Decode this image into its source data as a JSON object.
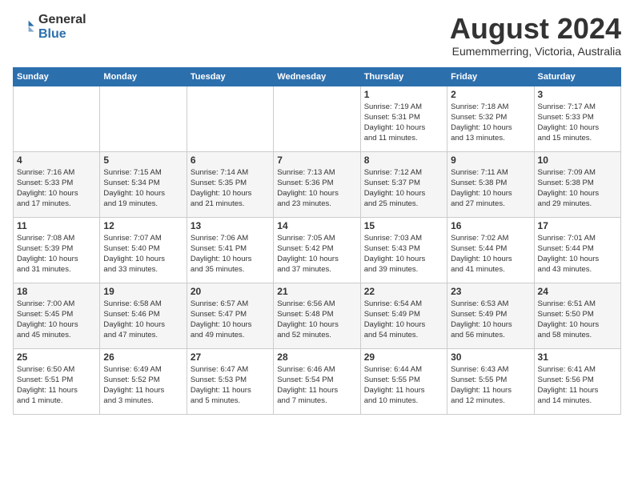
{
  "logo": {
    "general": "General",
    "blue": "Blue"
  },
  "title": "August 2024",
  "location": "Eumemmerring, Victoria, Australia",
  "days_header": [
    "Sunday",
    "Monday",
    "Tuesday",
    "Wednesday",
    "Thursday",
    "Friday",
    "Saturday"
  ],
  "weeks": [
    [
      {
        "day": "",
        "info": ""
      },
      {
        "day": "",
        "info": ""
      },
      {
        "day": "",
        "info": ""
      },
      {
        "day": "",
        "info": ""
      },
      {
        "day": "1",
        "info": "Sunrise: 7:19 AM\nSunset: 5:31 PM\nDaylight: 10 hours\nand 11 minutes."
      },
      {
        "day": "2",
        "info": "Sunrise: 7:18 AM\nSunset: 5:32 PM\nDaylight: 10 hours\nand 13 minutes."
      },
      {
        "day": "3",
        "info": "Sunrise: 7:17 AM\nSunset: 5:33 PM\nDaylight: 10 hours\nand 15 minutes."
      }
    ],
    [
      {
        "day": "4",
        "info": "Sunrise: 7:16 AM\nSunset: 5:33 PM\nDaylight: 10 hours\nand 17 minutes."
      },
      {
        "day": "5",
        "info": "Sunrise: 7:15 AM\nSunset: 5:34 PM\nDaylight: 10 hours\nand 19 minutes."
      },
      {
        "day": "6",
        "info": "Sunrise: 7:14 AM\nSunset: 5:35 PM\nDaylight: 10 hours\nand 21 minutes."
      },
      {
        "day": "7",
        "info": "Sunrise: 7:13 AM\nSunset: 5:36 PM\nDaylight: 10 hours\nand 23 minutes."
      },
      {
        "day": "8",
        "info": "Sunrise: 7:12 AM\nSunset: 5:37 PM\nDaylight: 10 hours\nand 25 minutes."
      },
      {
        "day": "9",
        "info": "Sunrise: 7:11 AM\nSunset: 5:38 PM\nDaylight: 10 hours\nand 27 minutes."
      },
      {
        "day": "10",
        "info": "Sunrise: 7:09 AM\nSunset: 5:38 PM\nDaylight: 10 hours\nand 29 minutes."
      }
    ],
    [
      {
        "day": "11",
        "info": "Sunrise: 7:08 AM\nSunset: 5:39 PM\nDaylight: 10 hours\nand 31 minutes."
      },
      {
        "day": "12",
        "info": "Sunrise: 7:07 AM\nSunset: 5:40 PM\nDaylight: 10 hours\nand 33 minutes."
      },
      {
        "day": "13",
        "info": "Sunrise: 7:06 AM\nSunset: 5:41 PM\nDaylight: 10 hours\nand 35 minutes."
      },
      {
        "day": "14",
        "info": "Sunrise: 7:05 AM\nSunset: 5:42 PM\nDaylight: 10 hours\nand 37 minutes."
      },
      {
        "day": "15",
        "info": "Sunrise: 7:03 AM\nSunset: 5:43 PM\nDaylight: 10 hours\nand 39 minutes."
      },
      {
        "day": "16",
        "info": "Sunrise: 7:02 AM\nSunset: 5:44 PM\nDaylight: 10 hours\nand 41 minutes."
      },
      {
        "day": "17",
        "info": "Sunrise: 7:01 AM\nSunset: 5:44 PM\nDaylight: 10 hours\nand 43 minutes."
      }
    ],
    [
      {
        "day": "18",
        "info": "Sunrise: 7:00 AM\nSunset: 5:45 PM\nDaylight: 10 hours\nand 45 minutes."
      },
      {
        "day": "19",
        "info": "Sunrise: 6:58 AM\nSunset: 5:46 PM\nDaylight: 10 hours\nand 47 minutes."
      },
      {
        "day": "20",
        "info": "Sunrise: 6:57 AM\nSunset: 5:47 PM\nDaylight: 10 hours\nand 49 minutes."
      },
      {
        "day": "21",
        "info": "Sunrise: 6:56 AM\nSunset: 5:48 PM\nDaylight: 10 hours\nand 52 minutes."
      },
      {
        "day": "22",
        "info": "Sunrise: 6:54 AM\nSunset: 5:49 PM\nDaylight: 10 hours\nand 54 minutes."
      },
      {
        "day": "23",
        "info": "Sunrise: 6:53 AM\nSunset: 5:49 PM\nDaylight: 10 hours\nand 56 minutes."
      },
      {
        "day": "24",
        "info": "Sunrise: 6:51 AM\nSunset: 5:50 PM\nDaylight: 10 hours\nand 58 minutes."
      }
    ],
    [
      {
        "day": "25",
        "info": "Sunrise: 6:50 AM\nSunset: 5:51 PM\nDaylight: 11 hours\nand 1 minute."
      },
      {
        "day": "26",
        "info": "Sunrise: 6:49 AM\nSunset: 5:52 PM\nDaylight: 11 hours\nand 3 minutes."
      },
      {
        "day": "27",
        "info": "Sunrise: 6:47 AM\nSunset: 5:53 PM\nDaylight: 11 hours\nand 5 minutes."
      },
      {
        "day": "28",
        "info": "Sunrise: 6:46 AM\nSunset: 5:54 PM\nDaylight: 11 hours\nand 7 minutes."
      },
      {
        "day": "29",
        "info": "Sunrise: 6:44 AM\nSunset: 5:55 PM\nDaylight: 11 hours\nand 10 minutes."
      },
      {
        "day": "30",
        "info": "Sunrise: 6:43 AM\nSunset: 5:55 PM\nDaylight: 11 hours\nand 12 minutes."
      },
      {
        "day": "31",
        "info": "Sunrise: 6:41 AM\nSunset: 5:56 PM\nDaylight: 11 hours\nand 14 minutes."
      }
    ]
  ]
}
